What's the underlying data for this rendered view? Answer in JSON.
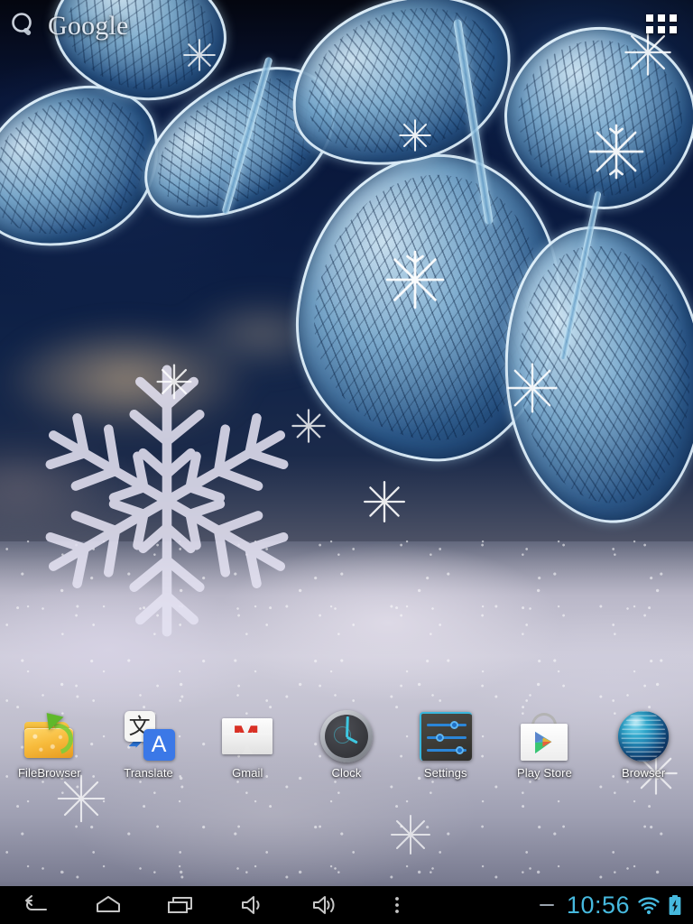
{
  "search_widget": {
    "logo_text": "Google",
    "icon": "search-icon"
  },
  "app_drawer": {
    "label": "Apps",
    "icon": "apps-grid-icon"
  },
  "home_apps": [
    {
      "label": "FileBrowser",
      "icon": "filebrowser-icon"
    },
    {
      "label": "Translate",
      "icon": "translate-icon"
    },
    {
      "label": "Gmail",
      "icon": "gmail-icon",
      "glyph": "M"
    },
    {
      "label": "Clock",
      "icon": "clock-icon"
    },
    {
      "label": "Settings",
      "icon": "settings-icon"
    },
    {
      "label": "Play Store",
      "icon": "play-store-icon"
    },
    {
      "label": "Browser",
      "icon": "browser-globe-icon"
    }
  ],
  "translate_icon": {
    "source_glyph": "文",
    "target_glyph": "A"
  },
  "nav_bar": {
    "buttons": [
      {
        "name": "back",
        "label": "Back",
        "icon": "back-arrow-icon"
      },
      {
        "name": "home",
        "label": "Home",
        "icon": "home-icon"
      },
      {
        "name": "recents",
        "label": "Recent apps",
        "icon": "recents-icon"
      },
      {
        "name": "volume-down",
        "label": "Volume down",
        "icon": "volume-down-icon"
      },
      {
        "name": "volume-up",
        "label": "Volume up",
        "icon": "volume-up-icon"
      },
      {
        "name": "menu",
        "label": "More options",
        "icon": "overflow-menu-icon"
      }
    ]
  },
  "status_bar": {
    "time": "10:56",
    "wifi_icon": "wifi-full-icon",
    "battery_icon": "battery-charging-icon",
    "separator": "dash"
  },
  "colors": {
    "accent_cyan": "#46b9de",
    "nav_bar_bg": "#000000",
    "icon_label": "#ffffff",
    "wallpaper_sky": "#0b1c42",
    "wallpaper_ground": "#cfcddb"
  }
}
